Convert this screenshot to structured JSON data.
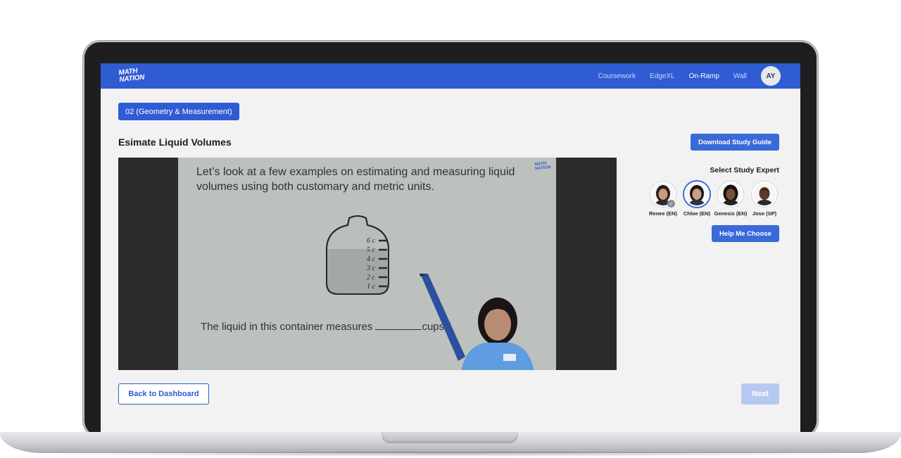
{
  "nav": {
    "logo_line1": "MATH",
    "logo_line2": "NATION",
    "links": [
      "Coursework",
      "EdgeXL",
      "On-Ramp",
      "Wall"
    ],
    "active_link": "On-Ramp",
    "user_initials": "AY"
  },
  "unit": {
    "label": "02 (Geometry & Measurement)"
  },
  "lesson": {
    "title": "Esimate Liquid Volumes"
  },
  "actions": {
    "download_label": "Download Study Guide",
    "help_label": "Help Me Choose",
    "back_label": "Back to Dashboard",
    "next_label": "Next"
  },
  "video": {
    "slide_text": "Let’s look at a few examples on estimating and measuring liquid volumes using both customary and metric units.",
    "jar_marks": [
      "6 c",
      "5 c",
      "4 c",
      "3 c",
      "2 c",
      "1 c"
    ],
    "question_prefix": "The liquid in this container measures",
    "question_suffix": "cups (",
    "logo_line1": "MATH",
    "logo_line2": "NATION"
  },
  "experts": {
    "title": "Select Study Expert",
    "list": [
      {
        "name": "Renee (EN)",
        "selected": false
      },
      {
        "name": "Chloe (EN)",
        "selected": true
      },
      {
        "name": "Genesis (EN)",
        "selected": false
      },
      {
        "name": "Jose (SP)",
        "selected": false
      }
    ]
  },
  "colors": {
    "brand": "#2f5bd3",
    "button": "#3a6ad8",
    "next_disabled": "#b7c9f0",
    "background": "#f2f2f3"
  }
}
